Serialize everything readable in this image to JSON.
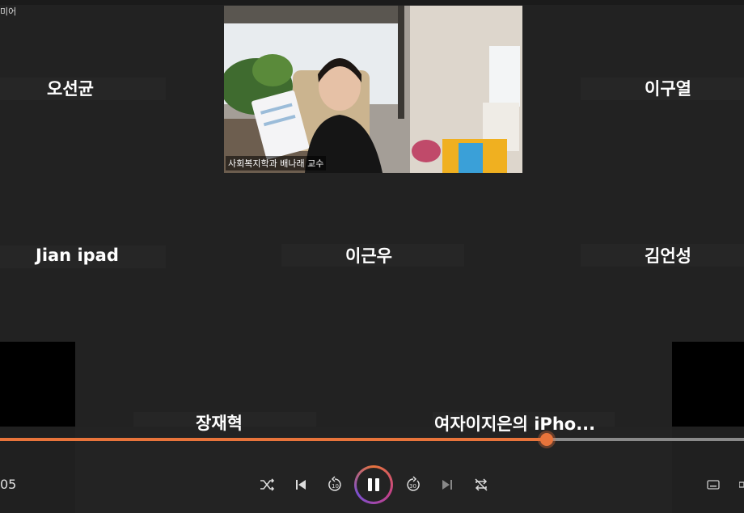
{
  "app": {
    "title": "미어"
  },
  "participants": {
    "top_left": "오선균",
    "top_right": "이구열",
    "mid_left": "Jian ipad",
    "mid_center": "이근우",
    "mid_right": "김언성",
    "bottom_left": "장재혁",
    "bottom_right": "여자이지은의 iPho..."
  },
  "video": {
    "caption": "사회복지학과 배나래 교수"
  },
  "player": {
    "time": "05",
    "progress": 0.735,
    "accent": "#e8743b"
  },
  "icons": [
    "shuffle-icon",
    "previous-icon",
    "rewind-10-icon",
    "pause-icon",
    "forward-30-icon",
    "next-icon",
    "repeat-icon",
    "subtitles-icon"
  ]
}
